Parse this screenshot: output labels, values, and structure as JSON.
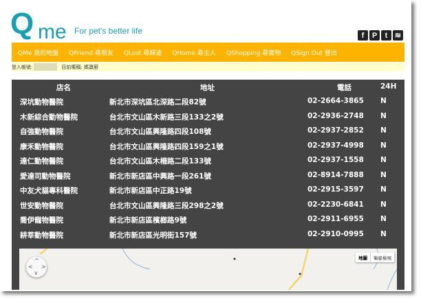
{
  "header": {
    "logo_q": "Q",
    "logo_me": "me",
    "tagline": "For pet's better life",
    "social": [
      {
        "icon": "facebook-icon",
        "glyph": "f"
      },
      {
        "icon": "pinterest-icon",
        "glyph": "P"
      },
      {
        "icon": "twitter-icon",
        "glyph": "t"
      },
      {
        "icon": "rss-icon",
        "glyph": "≋"
      }
    ]
  },
  "nav": {
    "items": [
      {
        "label": "QMe 我的地盤"
      },
      {
        "label": "QFriend 尋朋友"
      },
      {
        "label": "QLost 尋歸途"
      },
      {
        "label": "QHome 尋主人"
      },
      {
        "label": "QShopping 尋寶物"
      },
      {
        "label": "QSign Out 登出"
      }
    ],
    "color": "#fdb400"
  },
  "status": {
    "account_label": "登入帳號:",
    "account_value": "",
    "nickname_label": "目前暱稱:",
    "nickname_value": "媽寶廚"
  },
  "table": {
    "headers": [
      "店名",
      "地址",
      "電話",
      "24H"
    ],
    "rows": [
      [
        "深坑動物醫院",
        "新北市深坑區北深路二段82號",
        "02-2664-3865",
        "N"
      ],
      [
        "木新綜合動物醫院",
        "台北市文山區木新路三段133之2號",
        "02-2936-2748",
        "N"
      ],
      [
        "自強動物醫院",
        "台北市文山區興隆路四段108號",
        "02-2937-2852",
        "N"
      ],
      [
        "康禾動物醫院",
        "台北市文山區興隆路四段159之1號",
        "02-2937-4998",
        "N"
      ],
      [
        "達仁動物醫院",
        "台北市文山區木柵路二段133號",
        "02-2937-1558",
        "N"
      ],
      [
        "愛達司動物醫院",
        "新北市新店區中興路一段261號",
        "02-8914-7888",
        "N"
      ],
      [
        "中友犬貓專科醫院",
        "新北市新店區中正路19號",
        "02-2915-3597",
        "N"
      ],
      [
        "世安動物醫院",
        "台北市文山區興隆路三段298之2號",
        "02-2230-6841",
        "N"
      ],
      [
        "喬伊寵物醫院",
        "新北市新店區檳榔路9號",
        "02-2911-6955",
        "N"
      ],
      [
        "耕莘動物醫院",
        "新北市新店區光明街157號",
        "02-2910-0995",
        "N"
      ]
    ]
  },
  "map": {
    "type_buttons": [
      "地圖",
      "衛星檢視"
    ],
    "selected": "地圖",
    "pan": {
      "up": "^",
      "down": "v",
      "left": "<",
      "right": ">"
    }
  }
}
